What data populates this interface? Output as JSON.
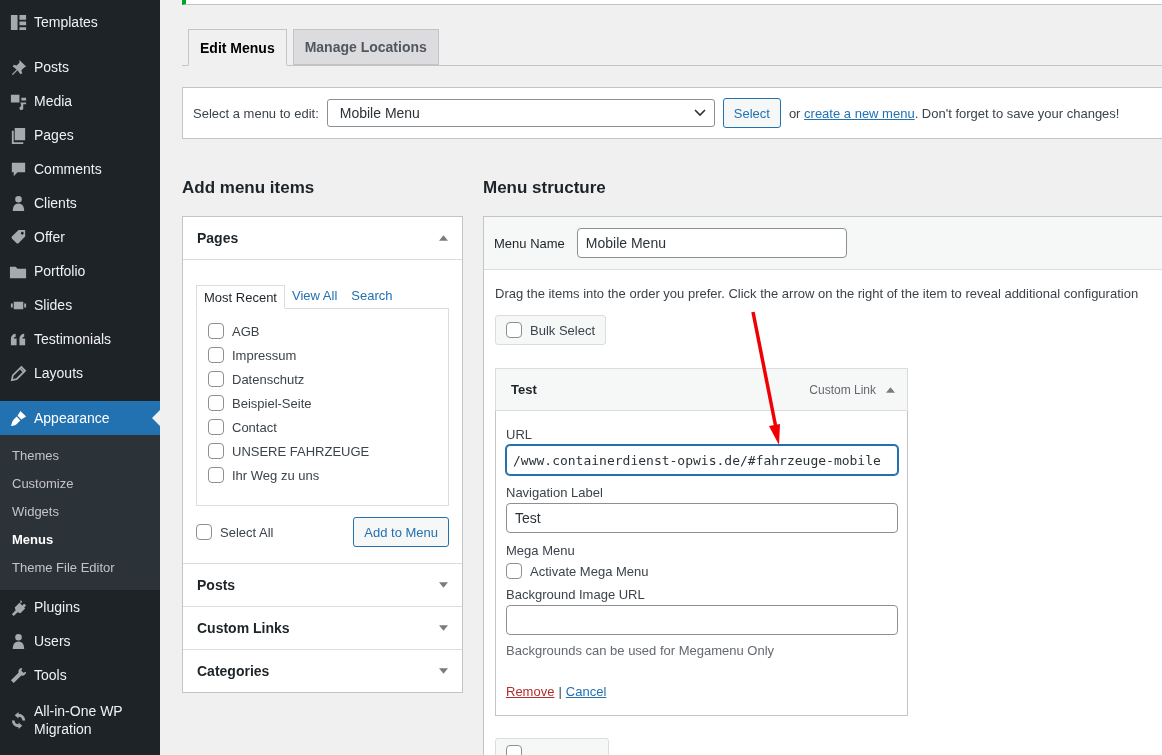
{
  "sidebar": {
    "items": [
      {
        "label": "Templates",
        "selected": false
      },
      {
        "label": "Posts",
        "selected": false
      },
      {
        "label": "Media",
        "selected": false
      },
      {
        "label": "Pages",
        "selected": false
      },
      {
        "label": "Comments",
        "selected": false
      },
      {
        "label": "Clients",
        "selected": false
      },
      {
        "label": "Offer",
        "selected": false
      },
      {
        "label": "Portfolio",
        "selected": false
      },
      {
        "label": "Slides",
        "selected": false
      },
      {
        "label": "Testimonials",
        "selected": false
      },
      {
        "label": "Layouts",
        "selected": false
      },
      {
        "label": "Appearance",
        "selected": true,
        "children": [
          {
            "label": "Themes",
            "selected": false
          },
          {
            "label": "Customize",
            "selected": false
          },
          {
            "label": "Widgets",
            "selected": false
          },
          {
            "label": "Menus",
            "selected": true
          },
          {
            "label": "Theme File Editor",
            "selected": false
          }
        ]
      },
      {
        "label": "Plugins",
        "selected": false
      },
      {
        "label": "Users",
        "selected": false
      },
      {
        "label": "Tools",
        "selected": false
      },
      {
        "label": "All-in-One WP Migration",
        "selected": false
      }
    ]
  },
  "tabs": [
    {
      "label": "Edit Menus",
      "selected": true
    },
    {
      "label": "Manage Locations",
      "selected": false
    }
  ],
  "menu_select": {
    "label": "Select a menu to edit:",
    "value": "Mobile Menu",
    "button": "Select",
    "hint_before": "or ",
    "link": "create a new menu",
    "hint_after": ". Don't forget to save your changes!"
  },
  "add_menu_items": {
    "title": "Add menu items",
    "sections": [
      {
        "title": "Pages",
        "expanded": true,
        "tabs": [
          {
            "label": "Most Recent",
            "selected": true
          },
          {
            "label": "View All",
            "selected": false
          },
          {
            "label": "Search",
            "selected": false
          }
        ],
        "items": [
          {
            "label": "AGB",
            "checked": false
          },
          {
            "label": "Impressum",
            "checked": false
          },
          {
            "label": "Datenschutz",
            "checked": false
          },
          {
            "label": "Beispiel-Seite",
            "checked": false
          },
          {
            "label": "Contact",
            "checked": false
          },
          {
            "label": "UNSERE FAHRZEUGE",
            "checked": false
          },
          {
            "label": "Ihr Weg zu uns",
            "checked": false
          }
        ],
        "select_all": {
          "label": "Select All",
          "checked": false
        },
        "button": "Add to Menu"
      },
      {
        "title": "Posts",
        "expanded": false
      },
      {
        "title": "Custom Links",
        "expanded": false
      },
      {
        "title": "Categories",
        "expanded": false
      }
    ]
  },
  "menu_structure": {
    "title": "Menu structure",
    "name_label": "Menu Name",
    "name_value": "Mobile Menu",
    "instructions": "Drag the items into the order you prefer. Click the arrow on the right of the item to reveal additional configuration",
    "bulk_select": {
      "label": "Bulk Select",
      "checked": false
    },
    "item": {
      "title": "Test",
      "type": "Custom Link",
      "expanded": true,
      "url_label": "URL",
      "url_value": "/www.containerdienst-opwis.de/#fahrzeuge-mobile",
      "nav_label": "Navigation Label",
      "nav_value": "Test",
      "mega_heading": "Mega Menu",
      "mega_checkbox": {
        "label": "Activate Mega Menu",
        "checked": false
      },
      "bg_label": "Background Image URL",
      "bg_note": "Backgrounds can be used for Megamenu Only",
      "remove": "Remove",
      "separator": "|",
      "cancel": "Cancel"
    },
    "bottom_bulk_select": {
      "checked": false
    }
  }
}
